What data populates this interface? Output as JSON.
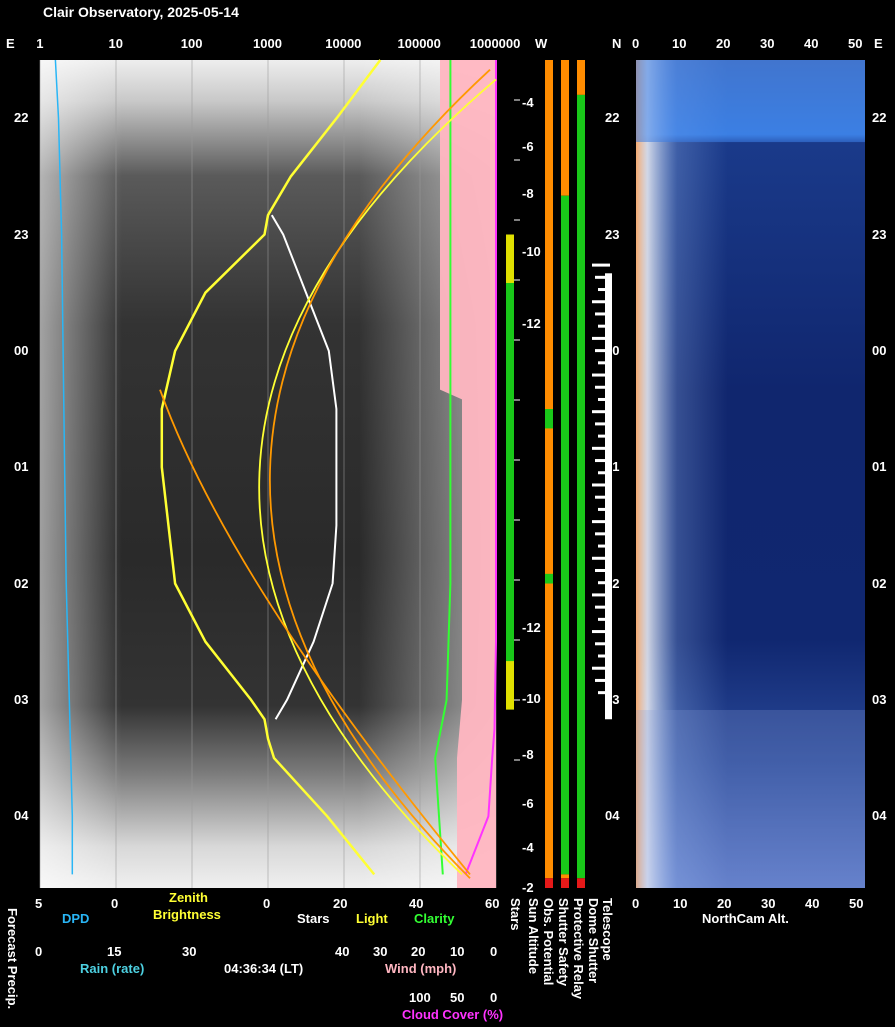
{
  "title": "Clair Observatory, 2025-05-14",
  "timestamp": "04:36:34 (LT)",
  "colors": {
    "dpd": "#29b6f6",
    "rain": "#4dd0e1",
    "zenith": "#ffff33",
    "sun_track": "#ff9900",
    "stars": "#ffffff",
    "clarity": "#33ff33",
    "wind": "#ffb6c1",
    "cloud": "#ff33ff",
    "status_green": "#19c819",
    "status_orange": "#ff8c00",
    "status_red": "#e61919"
  },
  "top_axis": {
    "left_label": "E",
    "log_ticks": [
      "1",
      "10",
      "100",
      "1000",
      "10000",
      "100000",
      "1000000"
    ],
    "w_label": "W",
    "n_label": "N",
    "alt_ticks": [
      "0",
      "10",
      "20",
      "30",
      "40",
      "50"
    ]
  },
  "time_ticks": [
    "22",
    "23",
    "00",
    "01",
    "02",
    "03",
    "04"
  ],
  "sun_altitude_ticks_top": [
    "-4",
    "-6",
    "-8",
    "-10",
    "-12"
  ],
  "sun_altitude_ticks_bottom": [
    "-12",
    "-10",
    "-8",
    "-6",
    "-4",
    "-2"
  ],
  "bottom": {
    "dpd_scale": [
      "5",
      "0"
    ],
    "dpd_label": "DPD",
    "zenith_label_1": "Zenith",
    "zenith_label_2": "Brightness",
    "sqm_scale": [
      "0",
      "20",
      "40",
      "60"
    ],
    "stars_label": "Stars",
    "light_label": "Light",
    "clarity_label": "Clarity",
    "rain_scale": [
      "0",
      "15",
      "30"
    ],
    "rain_label": "Rain (rate)",
    "wind_scale": [
      "40",
      "30",
      "20",
      "10",
      "0"
    ],
    "wind_label": "Wind (mph)",
    "cloud_scale": [
      "100",
      "50",
      "0"
    ],
    "cloud_label": "Cloud Cover (%)",
    "forecast_label": "Forecast Precip.",
    "status_labels": [
      "Stars",
      "Sun Altitude",
      "Obs. Potential",
      "Shutter Safety",
      "Protective Relay",
      "Dome Shutter",
      "Telescope"
    ],
    "northcam_scale": [
      "0",
      "10",
      "20",
      "30",
      "40",
      "50"
    ],
    "northcam_label": "NorthCam Alt."
  },
  "chart_data": {
    "type": "line",
    "time_axis": {
      "start": "21:30",
      "end": "04:37",
      "ticks": [
        "22",
        "23",
        "00",
        "01",
        "02",
        "03",
        "04"
      ]
    },
    "x_axis": {
      "scale": "log",
      "range": [
        1,
        1000000
      ]
    },
    "series": [
      {
        "name": "DPD",
        "x_range": [
          5,
          0
        ],
        "t": [
          "21:30",
          "22:00",
          "23:00",
          "00:00",
          "01:00",
          "02:00",
          "03:00",
          "04:00",
          "04:30"
        ],
        "values": [
          4.0,
          3.8,
          3.6,
          3.5,
          3.4,
          3.3,
          3.1,
          2.9,
          2.9
        ]
      },
      {
        "name": "Zenith Brightness",
        "x_range": [
          1,
          1000000
        ],
        "t": [
          "21:30",
          "22:00",
          "22:30",
          "22:50",
          "23:00",
          "23:30",
          "00:00",
          "00:30",
          "01:00",
          "02:00",
          "02:30",
          "03:00",
          "03:10",
          "03:20",
          "03:30",
          "04:00",
          "04:30"
        ],
        "values": [
          30000,
          8000,
          2000,
          1000,
          900,
          150,
          60,
          40,
          40,
          60,
          150,
          600,
          900,
          1000,
          1200,
          6000,
          25000
        ]
      },
      {
        "name": "Stars",
        "x_range": [
          0,
          60
        ],
        "t": [
          "22:50",
          "23:00",
          "23:30",
          "00:00",
          "00:30",
          "01:00",
          "01:30",
          "02:00",
          "02:30",
          "03:00",
          "03:10"
        ],
        "values": [
          1,
          4,
          10,
          16,
          18,
          18,
          18,
          17,
          12,
          5,
          2
        ]
      },
      {
        "name": "Clarity",
        "x_range": [
          0,
          60
        ],
        "t": [
          "21:30",
          "22:00",
          "23:00",
          "00:00",
          "01:00",
          "02:00",
          "03:00",
          "03:30",
          "04:00",
          "04:30"
        ],
        "values": [
          48,
          48,
          48,
          48,
          48,
          48,
          47,
          44,
          45,
          46
        ]
      },
      {
        "name": "Cloud Cover (%)",
        "x_range": [
          100,
          0
        ],
        "t": [
          "21:30",
          "22:30",
          "23:30",
          "00:30",
          "01:30",
          "02:30",
          "03:15",
          "03:30",
          "04:00",
          "04:30"
        ],
        "values": [
          0,
          0,
          0,
          0,
          0,
          0,
          2,
          5,
          10,
          40
        ]
      },
      {
        "name": "Sun Altitude",
        "y_unit": "deg",
        "t": [
          "21:30",
          "22:00",
          "22:30",
          "23:00",
          "23:30",
          "00:00",
          "00:30",
          "01:00",
          "01:30",
          "02:00",
          "02:30",
          "03:00",
          "03:30",
          "04:00",
          "04:30"
        ],
        "values": [
          -2.5,
          -4.5,
          -6.5,
          -8.5,
          -10.5,
          -12.0,
          -13.0,
          -13.2,
          -12.8,
          -12.0,
          -10.8,
          -9.2,
          -7.5,
          -5.5,
          -3.0
        ]
      }
    ]
  }
}
